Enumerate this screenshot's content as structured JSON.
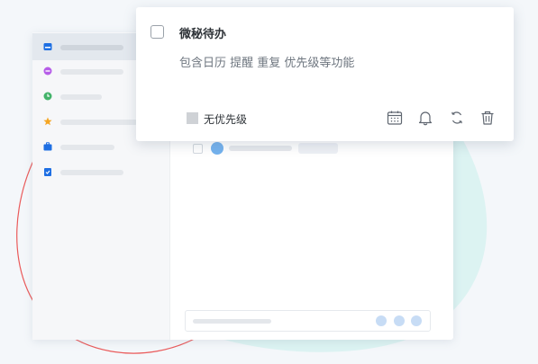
{
  "card": {
    "title": "微秘待办",
    "description": "包含日历 提醒 重复 优先级等功能",
    "priority_label": "无优先级",
    "toolbar": [
      "calendar-icon",
      "bell-icon",
      "repeat-icon",
      "trash-icon"
    ]
  },
  "sidebar": {
    "icons": [
      "inbox-icon",
      "circle-plus-icon",
      "clock-icon",
      "star-icon",
      "briefcase-icon",
      "clipboard-check-icon"
    ]
  },
  "colors": {
    "accent_blue": "#1e6fe3",
    "purple": "#b65de8",
    "green": "#43b36a",
    "orange": "#f5a623",
    "teal_blob": "#dcf3f2",
    "red_curve": "#ea5b5b"
  }
}
